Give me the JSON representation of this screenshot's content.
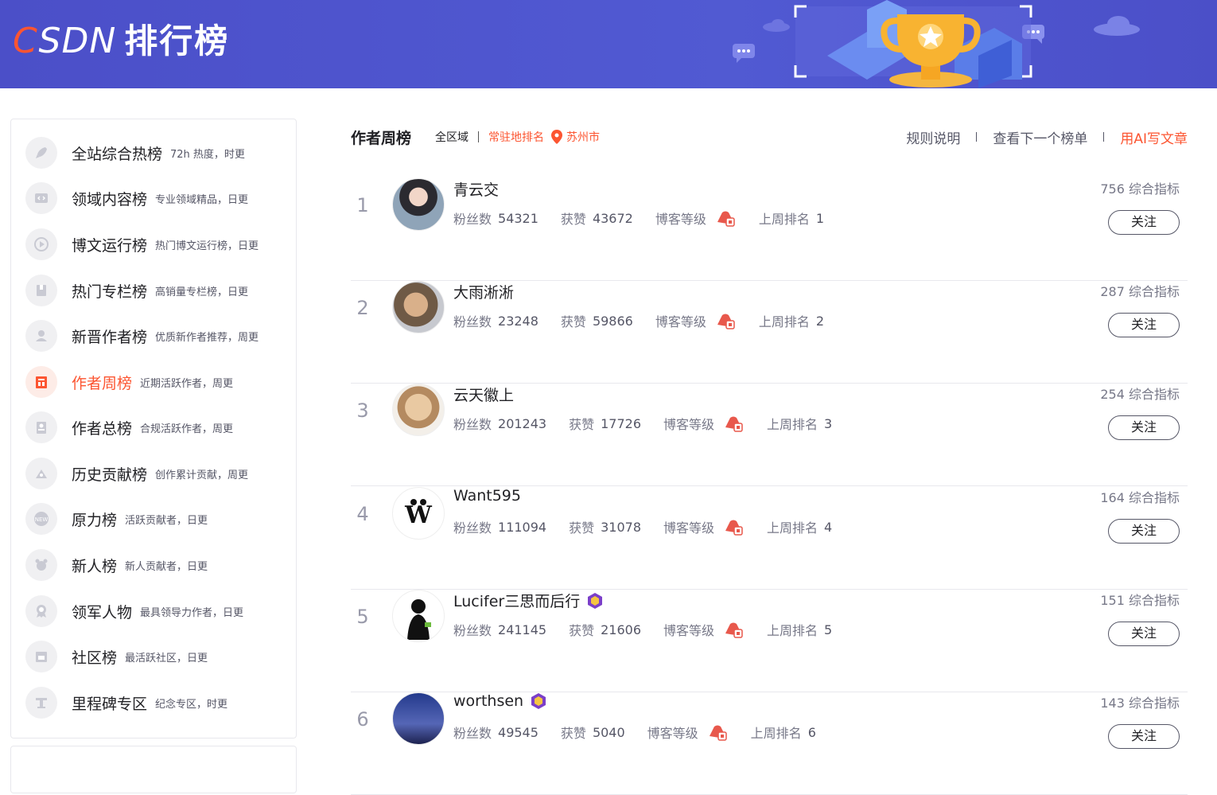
{
  "header": {
    "logo_text": "CSDN",
    "title": "排行榜"
  },
  "sidebar": {
    "items": [
      {
        "name": "全站综合热榜",
        "desc": "72h 热度，时更",
        "icon": "rocket-icon"
      },
      {
        "name": "领域内容榜",
        "desc": "专业领域精品，日更",
        "icon": "code-icon"
      },
      {
        "name": "博文运行榜",
        "desc": "热门博文运行榜，日更",
        "icon": "play-icon"
      },
      {
        "name": "热门专栏榜",
        "desc": "高销量专栏榜，日更",
        "icon": "book-icon"
      },
      {
        "name": "新晋作者榜",
        "desc": "优质新作者推荐，周更",
        "icon": "user-icon"
      },
      {
        "name": "作者周榜",
        "desc": "近期活跃作者，周更",
        "icon": "calendar-icon",
        "active": true
      },
      {
        "name": "作者总榜",
        "desc": "合规活跃作者，周更",
        "icon": "users-icon"
      },
      {
        "name": "历史贡献榜",
        "desc": "创作累计贡献，周更",
        "icon": "contribution-icon"
      },
      {
        "name": "原力榜",
        "desc": "活跃贡献者，日更",
        "icon": "new-badge-icon"
      },
      {
        "name": "新人榜",
        "desc": "新人贡献者，日更",
        "icon": "newcomer-icon"
      },
      {
        "name": "领军人物",
        "desc": "最具领导力作者，日更",
        "icon": "medal-icon"
      },
      {
        "name": "社区榜",
        "desc": "最活跃社区，日更",
        "icon": "community-icon"
      },
      {
        "name": "里程碑专区",
        "desc": "纪念专区，时更",
        "icon": "milestone-icon"
      }
    ]
  },
  "main": {
    "title": "作者周榜",
    "region": "全区域",
    "resident_label": "常驻地排名",
    "city": "苏州市",
    "links": {
      "rules": "规则说明",
      "next": "查看下一个榜单",
      "ai": "用AI写文章"
    },
    "labels": {
      "fans": "粉丝数",
      "likes": "获赞",
      "level": "博客等级",
      "last_rank": "上周排名",
      "follow": "关注"
    },
    "authors": [
      {
        "rank": "1",
        "name": "青云交",
        "fans": "54321",
        "likes": "43672",
        "last_rank": "1",
        "score": "756 综合指标",
        "vip": false
      },
      {
        "rank": "2",
        "name": "大雨淅淅",
        "fans": "23248",
        "likes": "59866",
        "last_rank": "2",
        "score": "287 综合指标",
        "vip": false
      },
      {
        "rank": "3",
        "name": "云天徽上",
        "fans": "201243",
        "likes": "17726",
        "last_rank": "3",
        "score": "254 综合指标",
        "vip": false
      },
      {
        "rank": "4",
        "name": "Want595",
        "fans": "111094",
        "likes": "31078",
        "last_rank": "4",
        "score": "164 综合指标",
        "vip": false
      },
      {
        "rank": "5",
        "name": "Lucifer三思而后行",
        "fans": "241145",
        "likes": "21606",
        "last_rank": "5",
        "score": "151 综合指标",
        "vip": true
      },
      {
        "rank": "6",
        "name": "worthsen",
        "fans": "49545",
        "likes": "5040",
        "last_rank": "6",
        "score": "143 综合指标",
        "vip": true
      }
    ]
  },
  "colors": {
    "banner": "#4b4fc8",
    "accent": "#fc5531"
  }
}
